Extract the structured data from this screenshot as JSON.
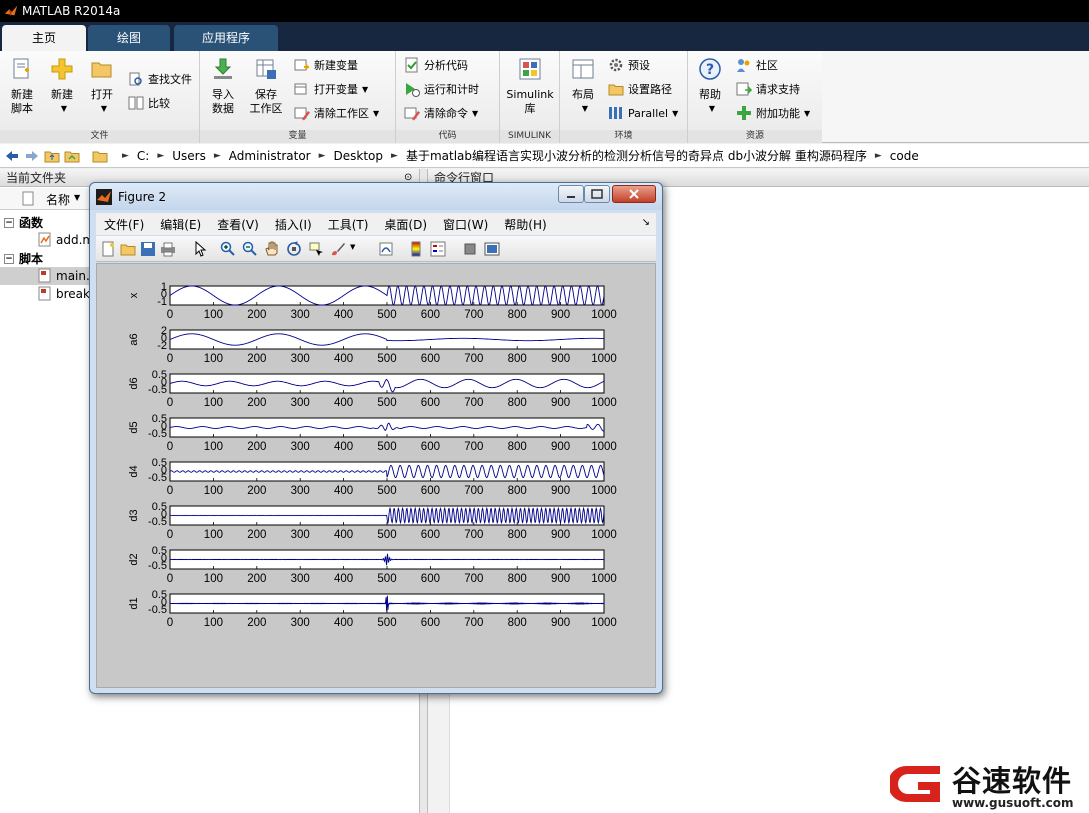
{
  "app": {
    "title": "MATLAB R2014a"
  },
  "ribbon": {
    "tabs": [
      {
        "label": "主页",
        "active": true
      },
      {
        "label": "绘图",
        "active": false
      },
      {
        "label": "应用程序",
        "active": false
      }
    ],
    "groups": {
      "file": {
        "label": "文件",
        "new_script": "新建\n脚本",
        "new": "新建",
        "open": "打开",
        "find_files": "查找文件",
        "compare": "比较"
      },
      "variable": {
        "label": "变量",
        "import_data": "导入\n数据",
        "save_workspace": "保存\n工作区",
        "new_variable": "新建变量",
        "open_variable": "打开变量",
        "clear_workspace": "清除工作区"
      },
      "code": {
        "label": "代码",
        "analyze_code": "分析代码",
        "run_and_time": "运行和计时",
        "clear_commands": "清除命令"
      },
      "simulink": {
        "label": "SIMULINK",
        "library": "Simulink\n库"
      },
      "environment": {
        "label": "环境",
        "layout": "布局",
        "preferences": "预设",
        "set_path": "设置路径",
        "parallel": "Parallel"
      },
      "resources": {
        "label": "资源",
        "help": "帮助",
        "community": "社区",
        "request_support": "请求支持",
        "add_ons": "附加功能"
      }
    }
  },
  "address": {
    "crumbs": [
      "C:",
      "Users",
      "Administrator",
      "Desktop",
      "基于matlab编程语言实现小波分析的检测分析信号的奇异点 db小波分解 重构源码程序",
      "code"
    ]
  },
  "current_folder": {
    "title": "当前文件夹",
    "column_name": "名称",
    "sections": [
      {
        "label": "函数",
        "files": [
          "add.m"
        ]
      },
      {
        "label": "脚本",
        "files": [
          "main.m",
          "break"
        ]
      }
    ]
  },
  "command_window": {
    "title": "命令行窗口"
  },
  "figure": {
    "title": "Figure 2",
    "menu": [
      "文件(F)",
      "编辑(E)",
      "查看(V)",
      "插入(I)",
      "工具(T)",
      "桌面(D)",
      "窗口(W)",
      "帮助(H)"
    ]
  },
  "chart_data": {
    "type": "line",
    "x_range": [
      0,
      1000
    ],
    "x_ticks": [
      0,
      100,
      200,
      300,
      400,
      500,
      600,
      700,
      800,
      900,
      1000
    ],
    "series_color": "#00008b",
    "subplots": [
      {
        "ylabel": "x",
        "yticks": [
          "1",
          "0",
          "-1"
        ],
        "ylim": [
          -1,
          1
        ]
      },
      {
        "ylabel": "a6",
        "yticks": [
          "2",
          "0",
          "-2"
        ],
        "ylim": [
          -2,
          2
        ]
      },
      {
        "ylabel": "d6",
        "yticks": [
          "0.5",
          "0",
          "-0.5"
        ],
        "ylim": [
          -0.5,
          0.5
        ]
      },
      {
        "ylabel": "d5",
        "yticks": [
          "0.5",
          "0",
          "-0.5"
        ],
        "ylim": [
          -0.5,
          0.5
        ]
      },
      {
        "ylabel": "d4",
        "yticks": [
          "0.5",
          "0",
          "-0.5"
        ],
        "ylim": [
          -0.5,
          0.5
        ]
      },
      {
        "ylabel": "d3",
        "yticks": [
          "0.5",
          "0",
          "-0.5"
        ],
        "ylim": [
          -0.5,
          0.5
        ]
      },
      {
        "ylabel": "d2",
        "yticks": [
          "0.5",
          "0",
          "-0.5"
        ],
        "ylim": [
          -0.5,
          0.5
        ]
      },
      {
        "ylabel": "d1",
        "yticks": [
          "0.5",
          "0",
          "-0.5"
        ],
        "ylim": [
          -0.5,
          0.5
        ]
      }
    ]
  },
  "watermark": {
    "brand": "谷速软件",
    "url": "www.gusuoft.com"
  }
}
